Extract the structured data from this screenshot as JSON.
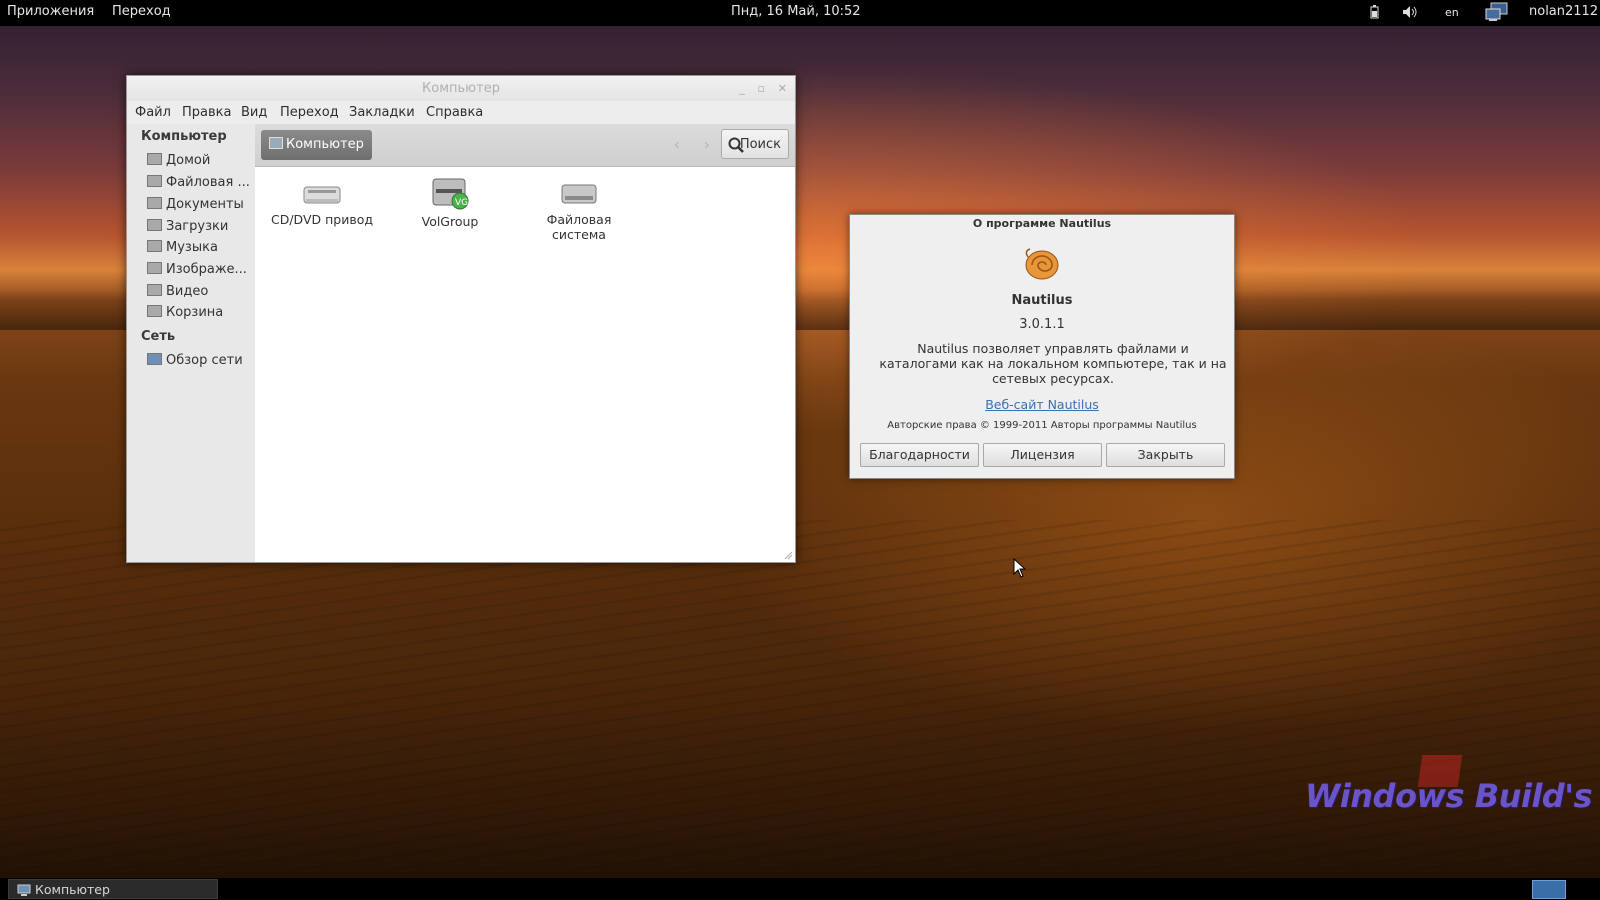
{
  "topbar": {
    "applications": "Приложения",
    "places": "Переход",
    "datetime": "Пнд, 16 Май, 10:52",
    "lang": "en",
    "user": "nolan2112"
  },
  "file_window": {
    "title": "Компьютер",
    "menu": [
      "Файл",
      "Правка",
      "Вид",
      "Переход",
      "Закладки",
      "Справка"
    ],
    "sidebar": {
      "computer_header": "Компьютер",
      "items": [
        "Домой",
        "Файловая ...",
        "Документы",
        "Загрузки",
        "Музыка",
        "Изображе...",
        "Видео",
        "Корзина"
      ],
      "network_header": "Сеть",
      "network_items": [
        "Обзор сети"
      ]
    },
    "breadcrumb": "Компьютер",
    "search_label": "Поиск",
    "files": [
      {
        "label": "CD/DVD привод",
        "icon": "optical-drive-icon"
      },
      {
        "label": "VolGroup",
        "icon": "volume-group-icon"
      },
      {
        "label": "Файловая система",
        "icon": "harddisk-icon"
      }
    ]
  },
  "about_dialog": {
    "title": "О программе Nautilus",
    "app_name": "Nautilus",
    "version": "3.0.1.1",
    "description": "Nautilus позволяет управлять файлами и каталогами как на локальном компьютере, так и на сетевых ресурсах.",
    "website": "Веб-сайт Nautilus",
    "copyright": "Авторские права © 1999-2011 Авторы программы Nautilus",
    "buttons": [
      "Благодарности",
      "Лицензия",
      "Закрыть"
    ]
  },
  "watermark": "Windows Build's",
  "taskbar": {
    "task": "Компьютер"
  }
}
